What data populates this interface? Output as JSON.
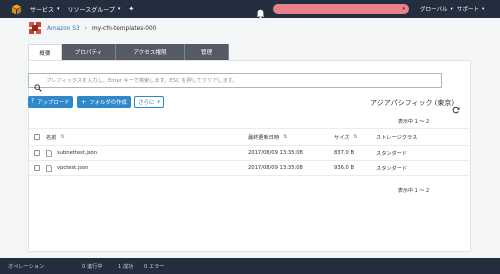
{
  "topnav": {
    "services": "サービス",
    "resource_groups": "リソースグループ",
    "region": "グローバル",
    "support": "サポート"
  },
  "breadcrumb": {
    "root": "Amazon S3",
    "bucket": "my-cfn-templates-000"
  },
  "tabs": [
    {
      "label": "概要"
    },
    {
      "label": "プロパティ"
    },
    {
      "label": "アクセス権限"
    },
    {
      "label": "管理"
    }
  ],
  "search": {
    "placeholder": "プレフィックスを入力し、Enter キーで検索します。ESC を押してクリアします。"
  },
  "actions": {
    "upload": "アップロード",
    "create_folder": "フォルダの作成",
    "more": "さらに"
  },
  "region_name": "アジアパシフィック (東京)",
  "pagination": {
    "top": "表示中 1 ～ 2",
    "bottom": "表示中 1 ～ 2"
  },
  "table": {
    "columns": {
      "name": "名前",
      "last_modified": "最終更新日時",
      "size": "サイズ",
      "storage_class": "ストレージクラス"
    },
    "rows": [
      {
        "name": "subnettest.json",
        "last_modified": "2017/08/09 13:35:08",
        "size": "837.0 B",
        "storage_class": "スタンダード"
      },
      {
        "name": "vpctest.json",
        "last_modified": "2017/08/09 13:35:08",
        "size": "936.0 B",
        "storage_class": "スタンダード"
      }
    ]
  },
  "statusbar": {
    "label": "オペレーション",
    "in_progress": "0 進行中",
    "success": "1 成功",
    "error": "0 エラー"
  },
  "colors": {
    "nav_bg": "#232f3e",
    "primary_button": "#2f88c9",
    "link": "#2a7ab0",
    "account_pill": "#e8818a"
  }
}
